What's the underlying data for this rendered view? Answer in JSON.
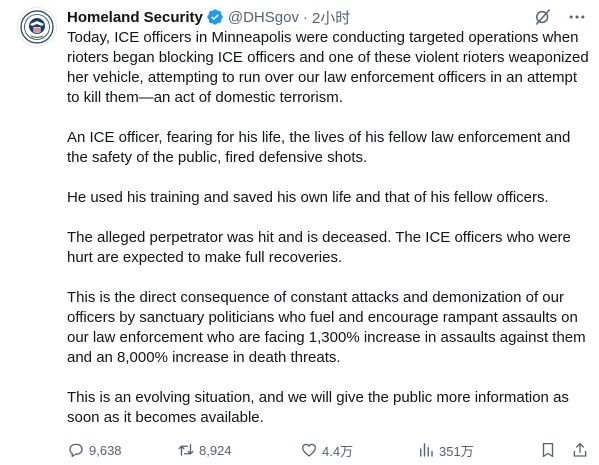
{
  "author": {
    "name": "Homeland Security",
    "handle": "@DHSgov",
    "separator": "·",
    "time": "2小时"
  },
  "tweet": {
    "paragraphs": [
      "Today, ICE officers in Minneapolis were conducting targeted operations when rioters began blocking ICE officers and one of these violent rioters weaponized her vehicle, attempting to run over our law enforcement officers in an attempt to kill them—an act of domestic terrorism.",
      "An ICE officer, fearing for his life, the lives of his fellow law enforcement and the safety of the public, fired defensive shots.",
      "He used his training and saved his own life and that of his fellow officers.",
      "The alleged perpetrator was hit and is deceased. The ICE officers who were hurt are expected to make full recoveries.",
      "This is the direct consequence of constant attacks and demonization of our officers by sanctuary politicians who fuel and encourage rampant assaults on our law enforcement who are facing 1,300% increase in assaults against them and an 8,000% increase in death threats.",
      "This is an evolving situation, and we will give the public more information as soon as it becomes available."
    ]
  },
  "actions": {
    "replies": "9,638",
    "reposts": "8,924",
    "likes": "4.4万",
    "views": "351万"
  },
  "icons": {
    "avatar": "dhs-seal-icon",
    "verified": "verified-badge-icon",
    "grok": "grok-icon",
    "more": "more-icon",
    "reply": "reply-icon",
    "repost": "repost-icon",
    "like": "heart-icon",
    "views": "views-icon",
    "bookmark": "bookmark-icon",
    "share": "share-icon"
  },
  "colors": {
    "text": "#0f1419",
    "muted": "#536471",
    "verified": "#1d9bf0"
  }
}
